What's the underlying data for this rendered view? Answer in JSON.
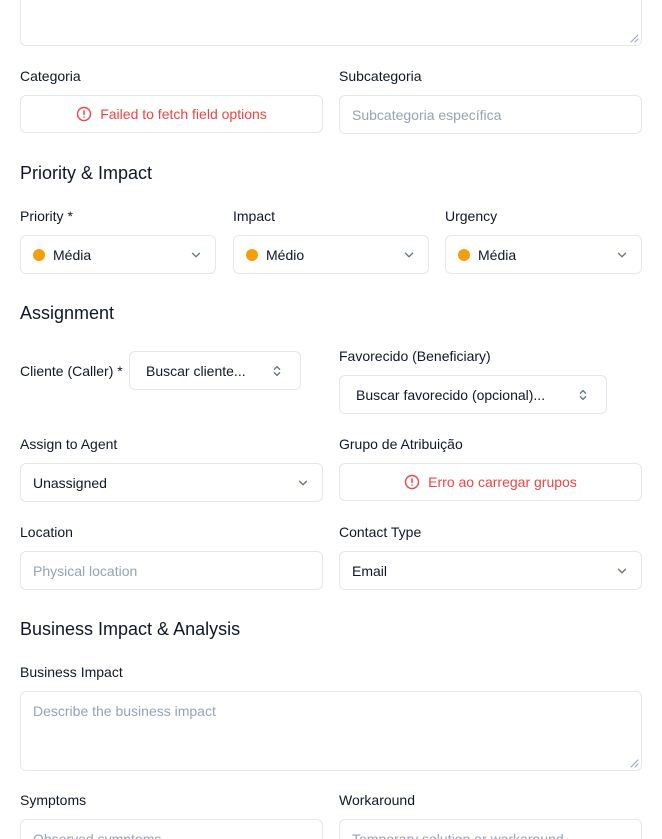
{
  "top_textarea": {},
  "categoria": {
    "label": "Categoria",
    "error": "Failed to fetch field options"
  },
  "subcategoria": {
    "label": "Subcategoria",
    "placeholder": "Subcategoria específica"
  },
  "priority_impact": {
    "title": "Priority & Impact",
    "priority": {
      "label": "Priority *",
      "value": "Média"
    },
    "impact": {
      "label": "Impact",
      "value": "Médio"
    },
    "urgency": {
      "label": "Urgency",
      "value": "Média"
    },
    "dot_color": "#f59e0b"
  },
  "assignment": {
    "title": "Assignment",
    "cliente": {
      "label": "Cliente (Caller) *",
      "value": "Buscar cliente..."
    },
    "favorecido": {
      "label": "Favorecido (Beneficiary)",
      "value": "Buscar favorecido (opcional)..."
    },
    "agent": {
      "label": "Assign to Agent",
      "value": "Unassigned"
    },
    "grupo": {
      "label": "Grupo de Atribuição",
      "error": "Erro ao carregar grupos"
    },
    "location": {
      "label": "Location",
      "placeholder": "Physical location"
    },
    "contact_type": {
      "label": "Contact Type",
      "value": "Email"
    }
  },
  "business": {
    "title": "Business Impact & Analysis",
    "impact": {
      "label": "Business Impact",
      "placeholder": "Describe the business impact"
    },
    "symptoms": {
      "label": "Symptoms",
      "placeholder": "Observed symptoms"
    },
    "workaround": {
      "label": "Workaround",
      "placeholder": "Temporary solution or workaround"
    }
  },
  "colors": {
    "error": "#ef4444",
    "border": "#e2e8f0",
    "placeholder": "#94a3b8",
    "text": "#0f172a"
  }
}
